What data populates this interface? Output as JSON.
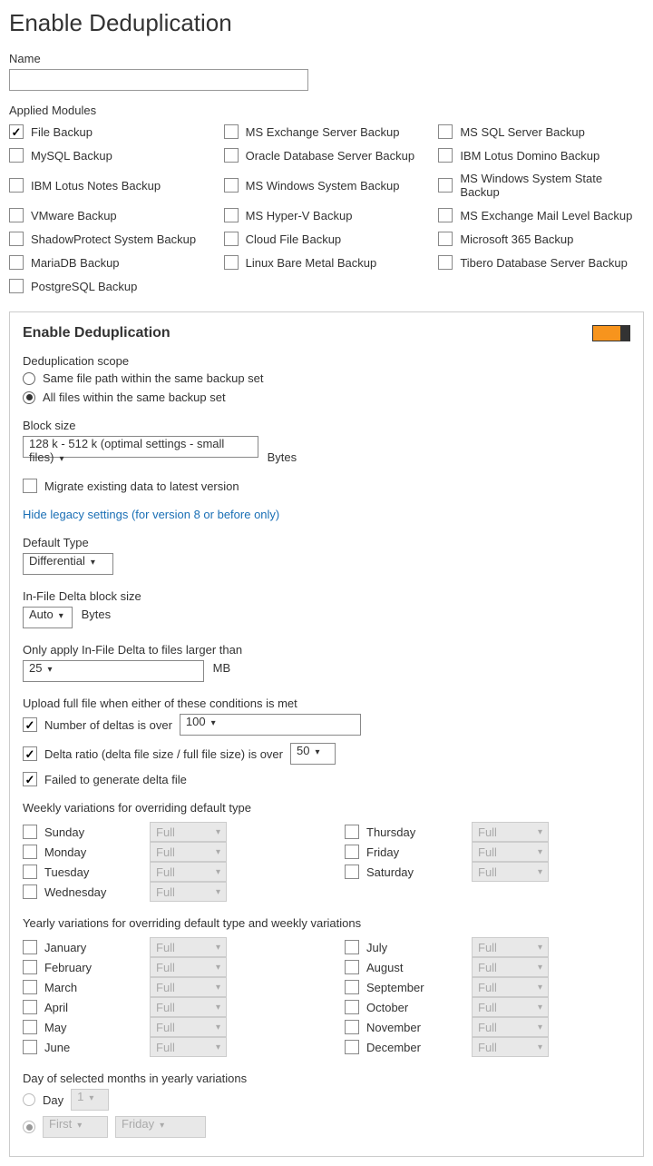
{
  "title": "Enable Deduplication",
  "name_label": "Name",
  "name_value": "",
  "applied_modules_label": "Applied Modules",
  "modules": [
    {
      "label": "File Backup",
      "checked": true
    },
    {
      "label": "MS Exchange Server Backup",
      "checked": false
    },
    {
      "label": "MS SQL Server Backup",
      "checked": false
    },
    {
      "label": "MySQL Backup",
      "checked": false
    },
    {
      "label": "Oracle Database Server Backup",
      "checked": false
    },
    {
      "label": "IBM Lotus Domino Backup",
      "checked": false
    },
    {
      "label": "IBM Lotus Notes Backup",
      "checked": false
    },
    {
      "label": "MS Windows System Backup",
      "checked": false
    },
    {
      "label": "MS Windows System State Backup",
      "checked": false
    },
    {
      "label": "VMware Backup",
      "checked": false
    },
    {
      "label": "MS Hyper-V Backup",
      "checked": false
    },
    {
      "label": "MS Exchange Mail Level Backup",
      "checked": false
    },
    {
      "label": "ShadowProtect System Backup",
      "checked": false
    },
    {
      "label": "Cloud File Backup",
      "checked": false
    },
    {
      "label": "Microsoft 365 Backup",
      "checked": false
    },
    {
      "label": "MariaDB Backup",
      "checked": false
    },
    {
      "label": "Linux Bare Metal Backup",
      "checked": false
    },
    {
      "label": "Tibero Database Server Backup",
      "checked": false
    },
    {
      "label": "PostgreSQL Backup",
      "checked": false
    }
  ],
  "panel": {
    "title": "Enable Deduplication",
    "scope_label": "Deduplication scope",
    "scope_option1": "Same file path within the same backup set",
    "scope_option2": "All files within the same backup set",
    "scope_selected": 2,
    "block_size_label": "Block size",
    "block_size_value": "128 k - 512 k (optimal settings - small files)",
    "block_size_unit": "Bytes",
    "migrate_label": "Migrate existing data to latest version",
    "migrate_checked": false,
    "legacy_link": "Hide legacy settings (for version 8 or before only)",
    "default_type_label": "Default Type",
    "default_type_value": "Differential",
    "infile_block_label": "In-File Delta block size",
    "infile_block_value": "Auto",
    "infile_block_unit": "Bytes",
    "apply_label": "Only apply In-File Delta to files larger than",
    "apply_value": "25",
    "apply_unit": "MB",
    "upload_label": "Upload full file when either of these conditions is met",
    "cond_num_label": "Number of deltas is over",
    "cond_num_value": "100",
    "cond_num_checked": true,
    "cond_ratio_label": "Delta ratio (delta file size / full file size) is over",
    "cond_ratio_value": "50",
    "cond_ratio_checked": true,
    "cond_failed_label": "Failed to generate delta file",
    "cond_failed_checked": true,
    "weekly_label": "Weekly variations for overriding default type",
    "weekly_left": [
      "Sunday",
      "Monday",
      "Tuesday",
      "Wednesday"
    ],
    "weekly_right": [
      "Thursday",
      "Friday",
      "Saturday"
    ],
    "full_text": "Full",
    "yearly_label": "Yearly variations for overriding default type and weekly variations",
    "yearly_left": [
      "January",
      "February",
      "March",
      "April",
      "May",
      "June"
    ],
    "yearly_right": [
      "July",
      "August",
      "September",
      "October",
      "November",
      "December"
    ],
    "day_label": "Day of selected months in yearly variations",
    "day_option_label": "Day",
    "day_value": "1",
    "ordinal_value": "First",
    "weekday_value": "Friday"
  }
}
